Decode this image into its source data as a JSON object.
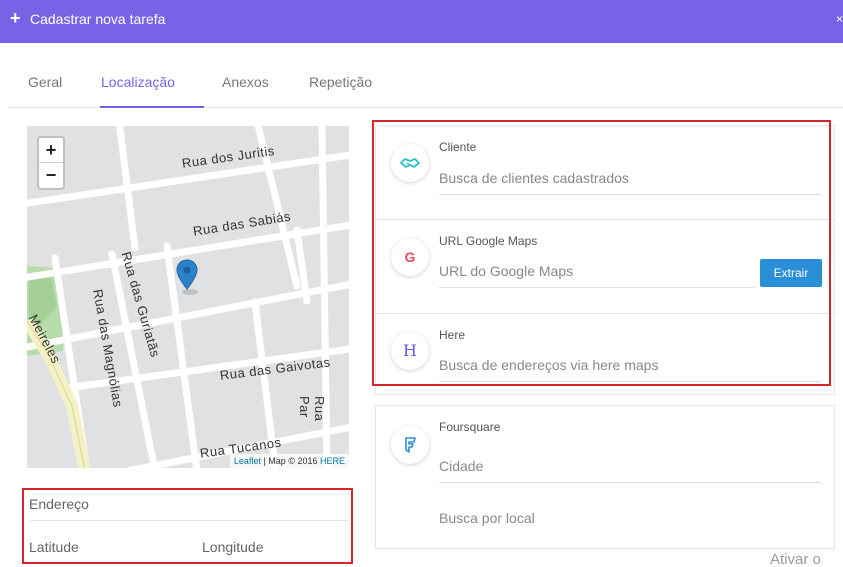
{
  "topbar": {
    "title": "Cadastrar nova tarefa",
    "background": "#7a62e6"
  },
  "tabs": [
    {
      "label": "Geral"
    },
    {
      "label": "Localização"
    },
    {
      "label": "Anexos"
    },
    {
      "label": "Repetição"
    }
  ],
  "active_tab": "Localização",
  "map": {
    "zoom_in": "+",
    "zoom_out": "−",
    "streets": [
      "Rua dos Juritis",
      "Rua das Sabiás",
      "Rua das Guriatãs",
      "Rua das Magnólias",
      "Rua das Gaivotas",
      "Rua Tucanos",
      "Rua Par",
      "Meireles"
    ],
    "attribution": {
      "leaflet": "Leaflet",
      "map_text": "| Map © 2016",
      "here": "HERE"
    }
  },
  "address": {
    "endereco": "Endereço",
    "latitude": "Latitude",
    "longitude": "Longitude"
  },
  "cliente": {
    "label": "Cliente",
    "placeholder": "Busca de clientes cadastrados"
  },
  "google": {
    "label": "URL Google Maps",
    "placeholder": "URL do Google Maps",
    "button": "Extrair",
    "icon_letter": "G"
  },
  "here_search": {
    "label": "Here",
    "placeholder": "Busca de endereços via here maps",
    "icon_letter": "H"
  },
  "foursquare": {
    "label": "Foursquare",
    "city_placeholder": "Cidade",
    "local_placeholder": "Busca por local"
  },
  "watermark": "Ativar o",
  "colors": {
    "accent": "#7a62e6",
    "highlight": "#d7252e",
    "button": "#2a8fd6",
    "marker": "#2c81cb"
  }
}
